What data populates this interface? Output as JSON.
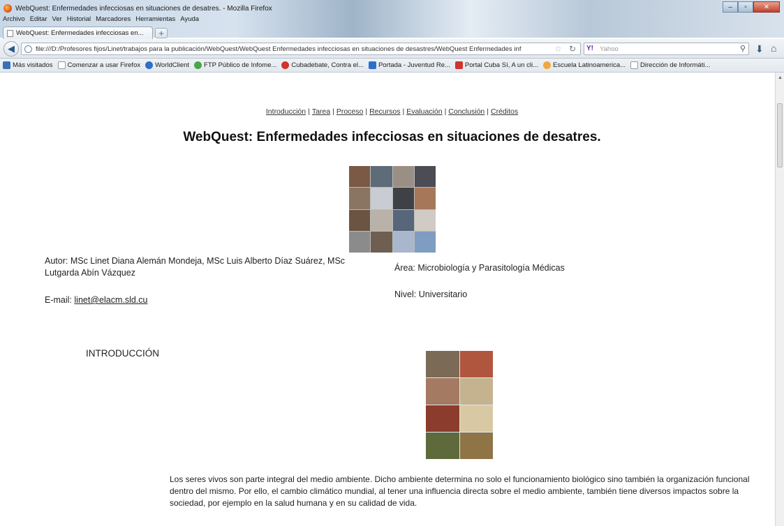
{
  "window": {
    "title": "WebQuest: Enfermedades infecciosas en situaciones de desatres. - Mozilla Firefox",
    "menu": [
      "Archivo",
      "Editar",
      "Ver",
      "Historial",
      "Marcadores",
      "Herramientas",
      "Ayuda"
    ]
  },
  "tab": {
    "label": "WebQuest: Enfermedades infecciosas en...",
    "new_tab": "+"
  },
  "navbar": {
    "url": "file:///D:/Profesores fijos/Linet/trabajos para la publicación/WebQuest/WebQuest Enfermedades infecciosas en situaciones de desastres/WebQuest Enfermedades inf",
    "search_placeholder": "Yahoo"
  },
  "bookmarks": [
    {
      "label": "Más visitados",
      "icon": "bookmark-folder-icon",
      "color": "#3b6fb6"
    },
    {
      "label": "Comenzar a usar Firefox",
      "icon": "page-icon",
      "color": "#ffffff"
    },
    {
      "label": "WorldClient",
      "icon": "globe-icon",
      "color": "#2d6fcb"
    },
    {
      "label": "FTP Público de Infome...",
      "icon": "ftp-icon",
      "color": "#48a548"
    },
    {
      "label": "Cubadebate, Contra el...",
      "icon": "cubadebate-icon",
      "color": "#d0342c"
    },
    {
      "label": "Portada - Juventud Re...",
      "icon": "newspaper-icon",
      "color": "#2d6fcb"
    },
    {
      "label": "Portal Cuba Sí, A un cli...",
      "icon": "portal-icon",
      "color": "#d0342c"
    },
    {
      "label": "Escuela Latinoamerica...",
      "icon": "school-icon",
      "color": "#f2a83a"
    },
    {
      "label": "Dirección de Informáti...",
      "icon": "page-icon",
      "color": "#ffffff"
    }
  ],
  "page": {
    "nav": [
      "Introducción",
      "Tarea",
      "Proceso",
      "Recursos",
      "Evaluación",
      "Conclusión",
      "Créditos"
    ],
    "title": "WebQuest: Enfermedades infecciosas en situaciones de desatres.",
    "author": "Autor: MSc Linet Diana Alemán Mondeja, MSc Luis Alberto Díaz Suárez, MSc Lutgarda Abín Vázquez",
    "email_label": "E-mail:",
    "email": "linet@elacm.sld.cu",
    "area": "Área: Microbiología y Parasitología Médicas",
    "nivel": "Nivel: Universitario",
    "intro_heading": "INTRODUCCIÓN",
    "intro_text": "Los seres vivos son parte integral del medio ambiente. Dicho ambiente determina no solo el funcionamiento biológico sino también la organización funcional dentro del mismo. Por ello, el cambio climático mundial, al tener una influencia directa sobre el medio ambiente, también tiene diversos impactos sobre la sociedad, por ejemplo en la salud humana y en su calidad de vida."
  }
}
